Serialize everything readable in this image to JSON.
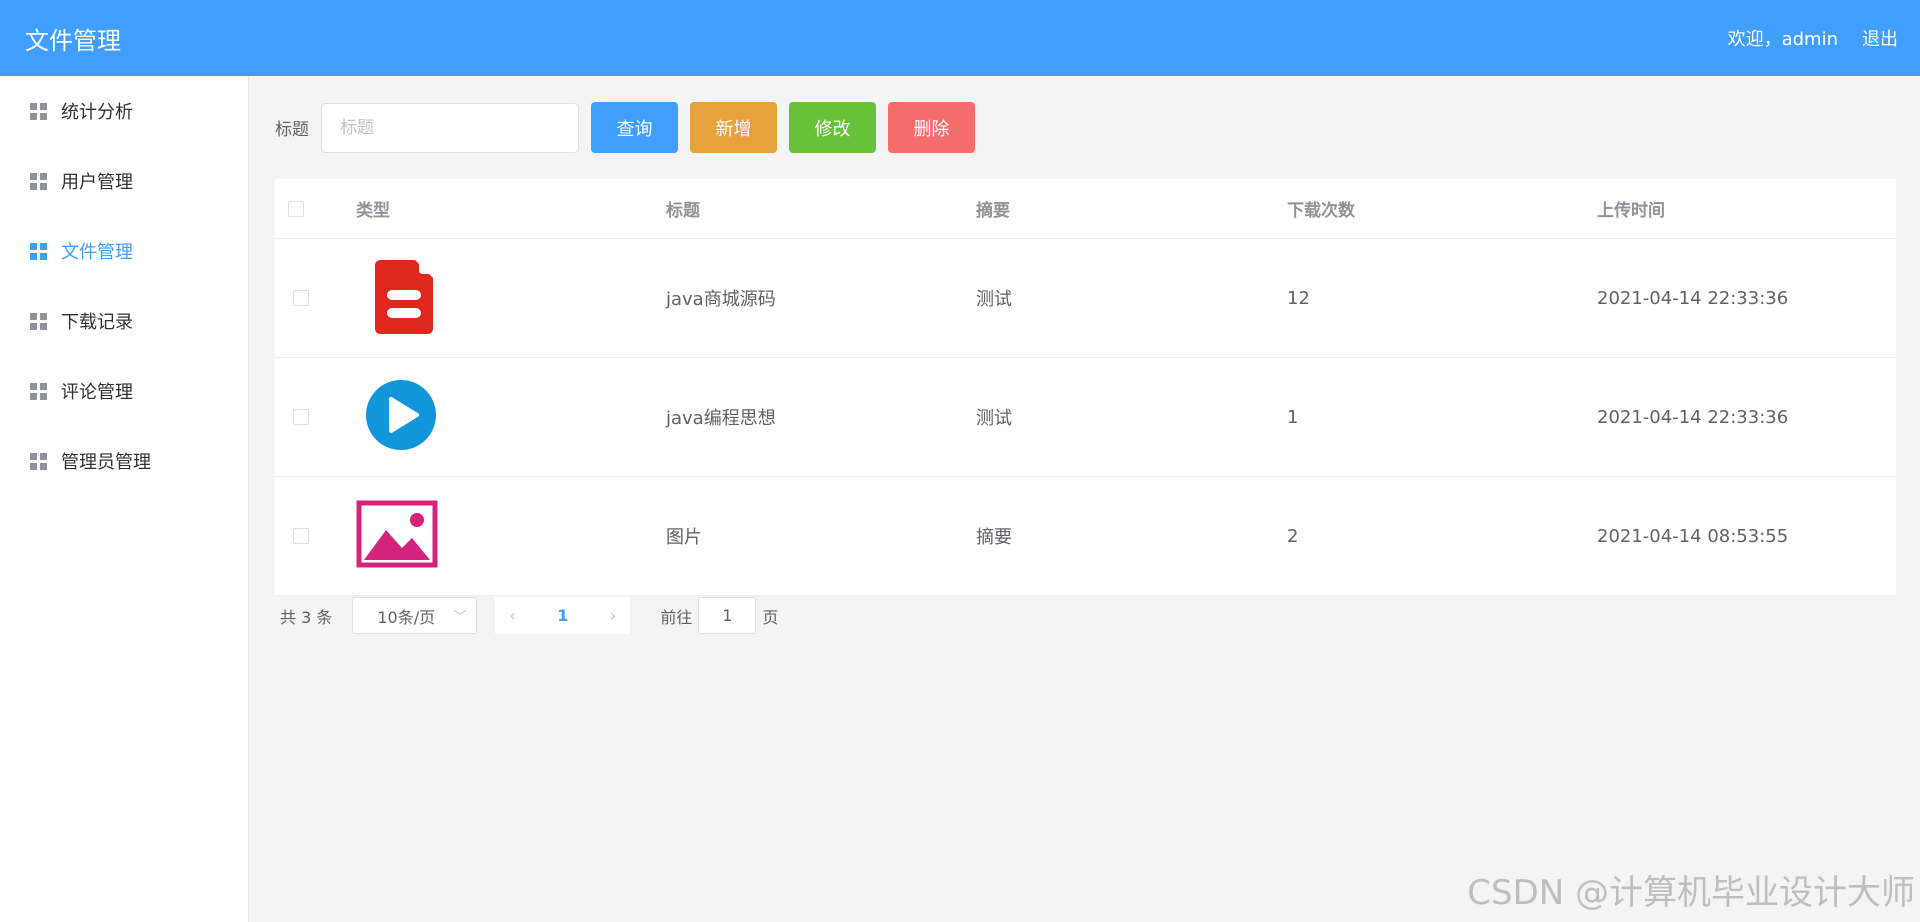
{
  "header": {
    "title": "文件管理",
    "welcome": "欢迎，admin",
    "logout": "退出"
  },
  "sidebar": {
    "items": [
      {
        "label": "统计分析"
      },
      {
        "label": "用户管理"
      },
      {
        "label": "文件管理",
        "active": true
      },
      {
        "label": "下载记录"
      },
      {
        "label": "评论管理"
      },
      {
        "label": "管理员管理"
      }
    ]
  },
  "toolbar": {
    "label": "标题",
    "placeholder": "标题",
    "value": "",
    "query": "查询",
    "add": "新增",
    "edit": "修改",
    "del": "删除"
  },
  "table": {
    "columns": [
      "类型",
      "标题",
      "摘要",
      "下载次数",
      "上传时间"
    ],
    "rows": [
      {
        "icon": "document-file-icon",
        "title": "java商城源码",
        "summary": "测试",
        "downloads": "12",
        "time": "2021-04-14 22:33:36"
      },
      {
        "icon": "video-play-icon",
        "title": "java编程思想",
        "summary": "测试",
        "downloads": "1",
        "time": "2021-04-14 22:33:36"
      },
      {
        "icon": "image-file-icon",
        "title": "图片",
        "summary": "摘要",
        "downloads": "2",
        "time": "2021-04-14 08:53:55"
      }
    ]
  },
  "pager": {
    "total": "共 3 条",
    "page_size": "10条/页",
    "current": "1",
    "goto_label": "前往",
    "goto_value": "1",
    "page_unit": "页"
  },
  "watermark": "CSDN @计算机毕业设计大师",
  "colors": {
    "primary": "#409eff",
    "warning": "#e6a23c",
    "success": "#67c23a",
    "danger": "#f56c6c"
  }
}
